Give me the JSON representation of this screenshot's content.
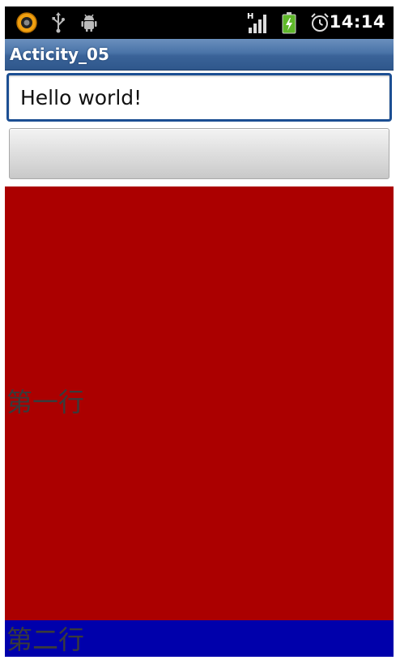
{
  "status_bar": {
    "time": "14:14",
    "network_type": "H",
    "icons": [
      "sync-app-icon",
      "usb-icon",
      "android-debug-icon",
      "signal-icon",
      "battery-charging-icon",
      "alarm-icon"
    ]
  },
  "title_bar": {
    "title": "Acticity_05"
  },
  "text_field": {
    "value": "Hello world!"
  },
  "button": {
    "label": ""
  },
  "rows": [
    {
      "label": "第一行",
      "color": "#ab0000"
    },
    {
      "label": "第二行",
      "color": "#0000ab"
    }
  ],
  "colors": {
    "status_bar_bg": "#000000",
    "title_bar_accent": "#3a6398",
    "field_border": "#1c4f93"
  }
}
